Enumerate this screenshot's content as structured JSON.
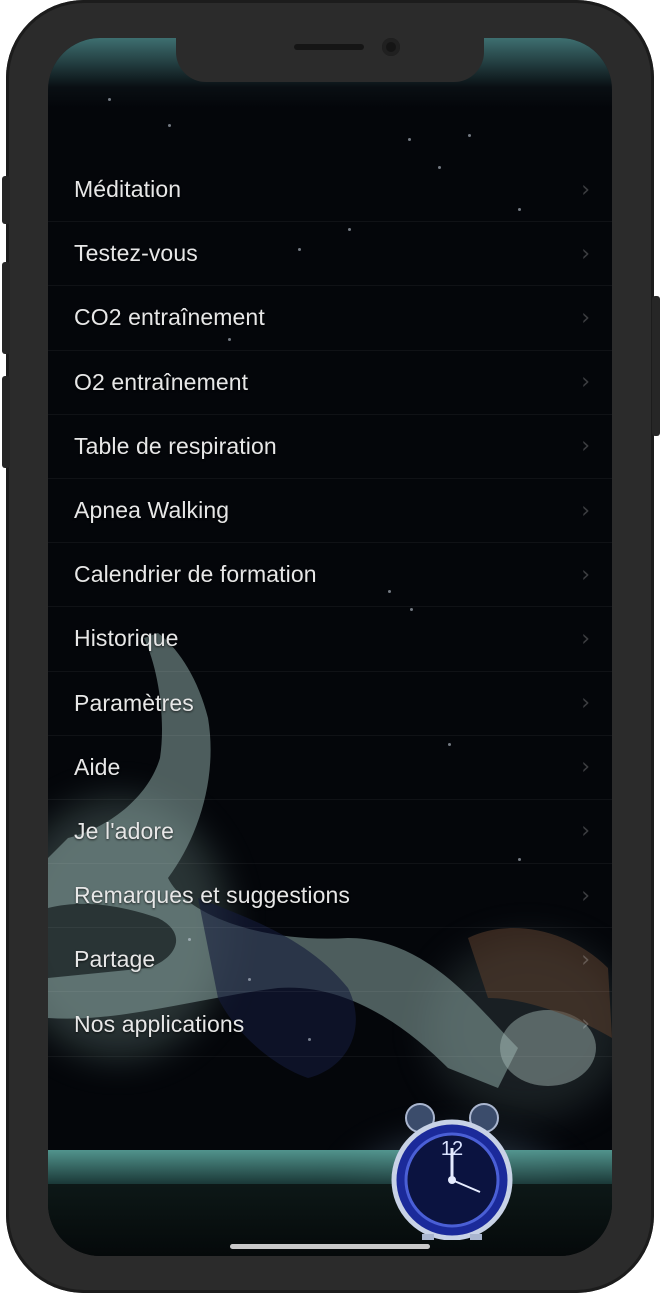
{
  "menu": {
    "items": [
      {
        "label": "Méditation"
      },
      {
        "label": "Testez-vous"
      },
      {
        "label": "CO2 entraînement"
      },
      {
        "label": "O2 entraînement"
      },
      {
        "label": "Table de respiration"
      },
      {
        "label": "Apnea Walking"
      },
      {
        "label": "Calendrier de formation"
      },
      {
        "label": "Historique"
      },
      {
        "label": "Paramètres"
      },
      {
        "label": "Aide"
      },
      {
        "label": "Je l'adore"
      },
      {
        "label": "Remarques et suggestions"
      },
      {
        "label": "Partage"
      },
      {
        "label": "Nos applications"
      }
    ],
    "chevron": "›"
  },
  "background": {
    "description_icon": "underwater-diver-with-alarm-clock-image",
    "clock_hour_label": "12"
  },
  "colors": {
    "text": "#e7e7e7",
    "screen_bg": "#04060a",
    "pool_edge": "#5aa39b",
    "clock_face": "#1b2a9a"
  }
}
